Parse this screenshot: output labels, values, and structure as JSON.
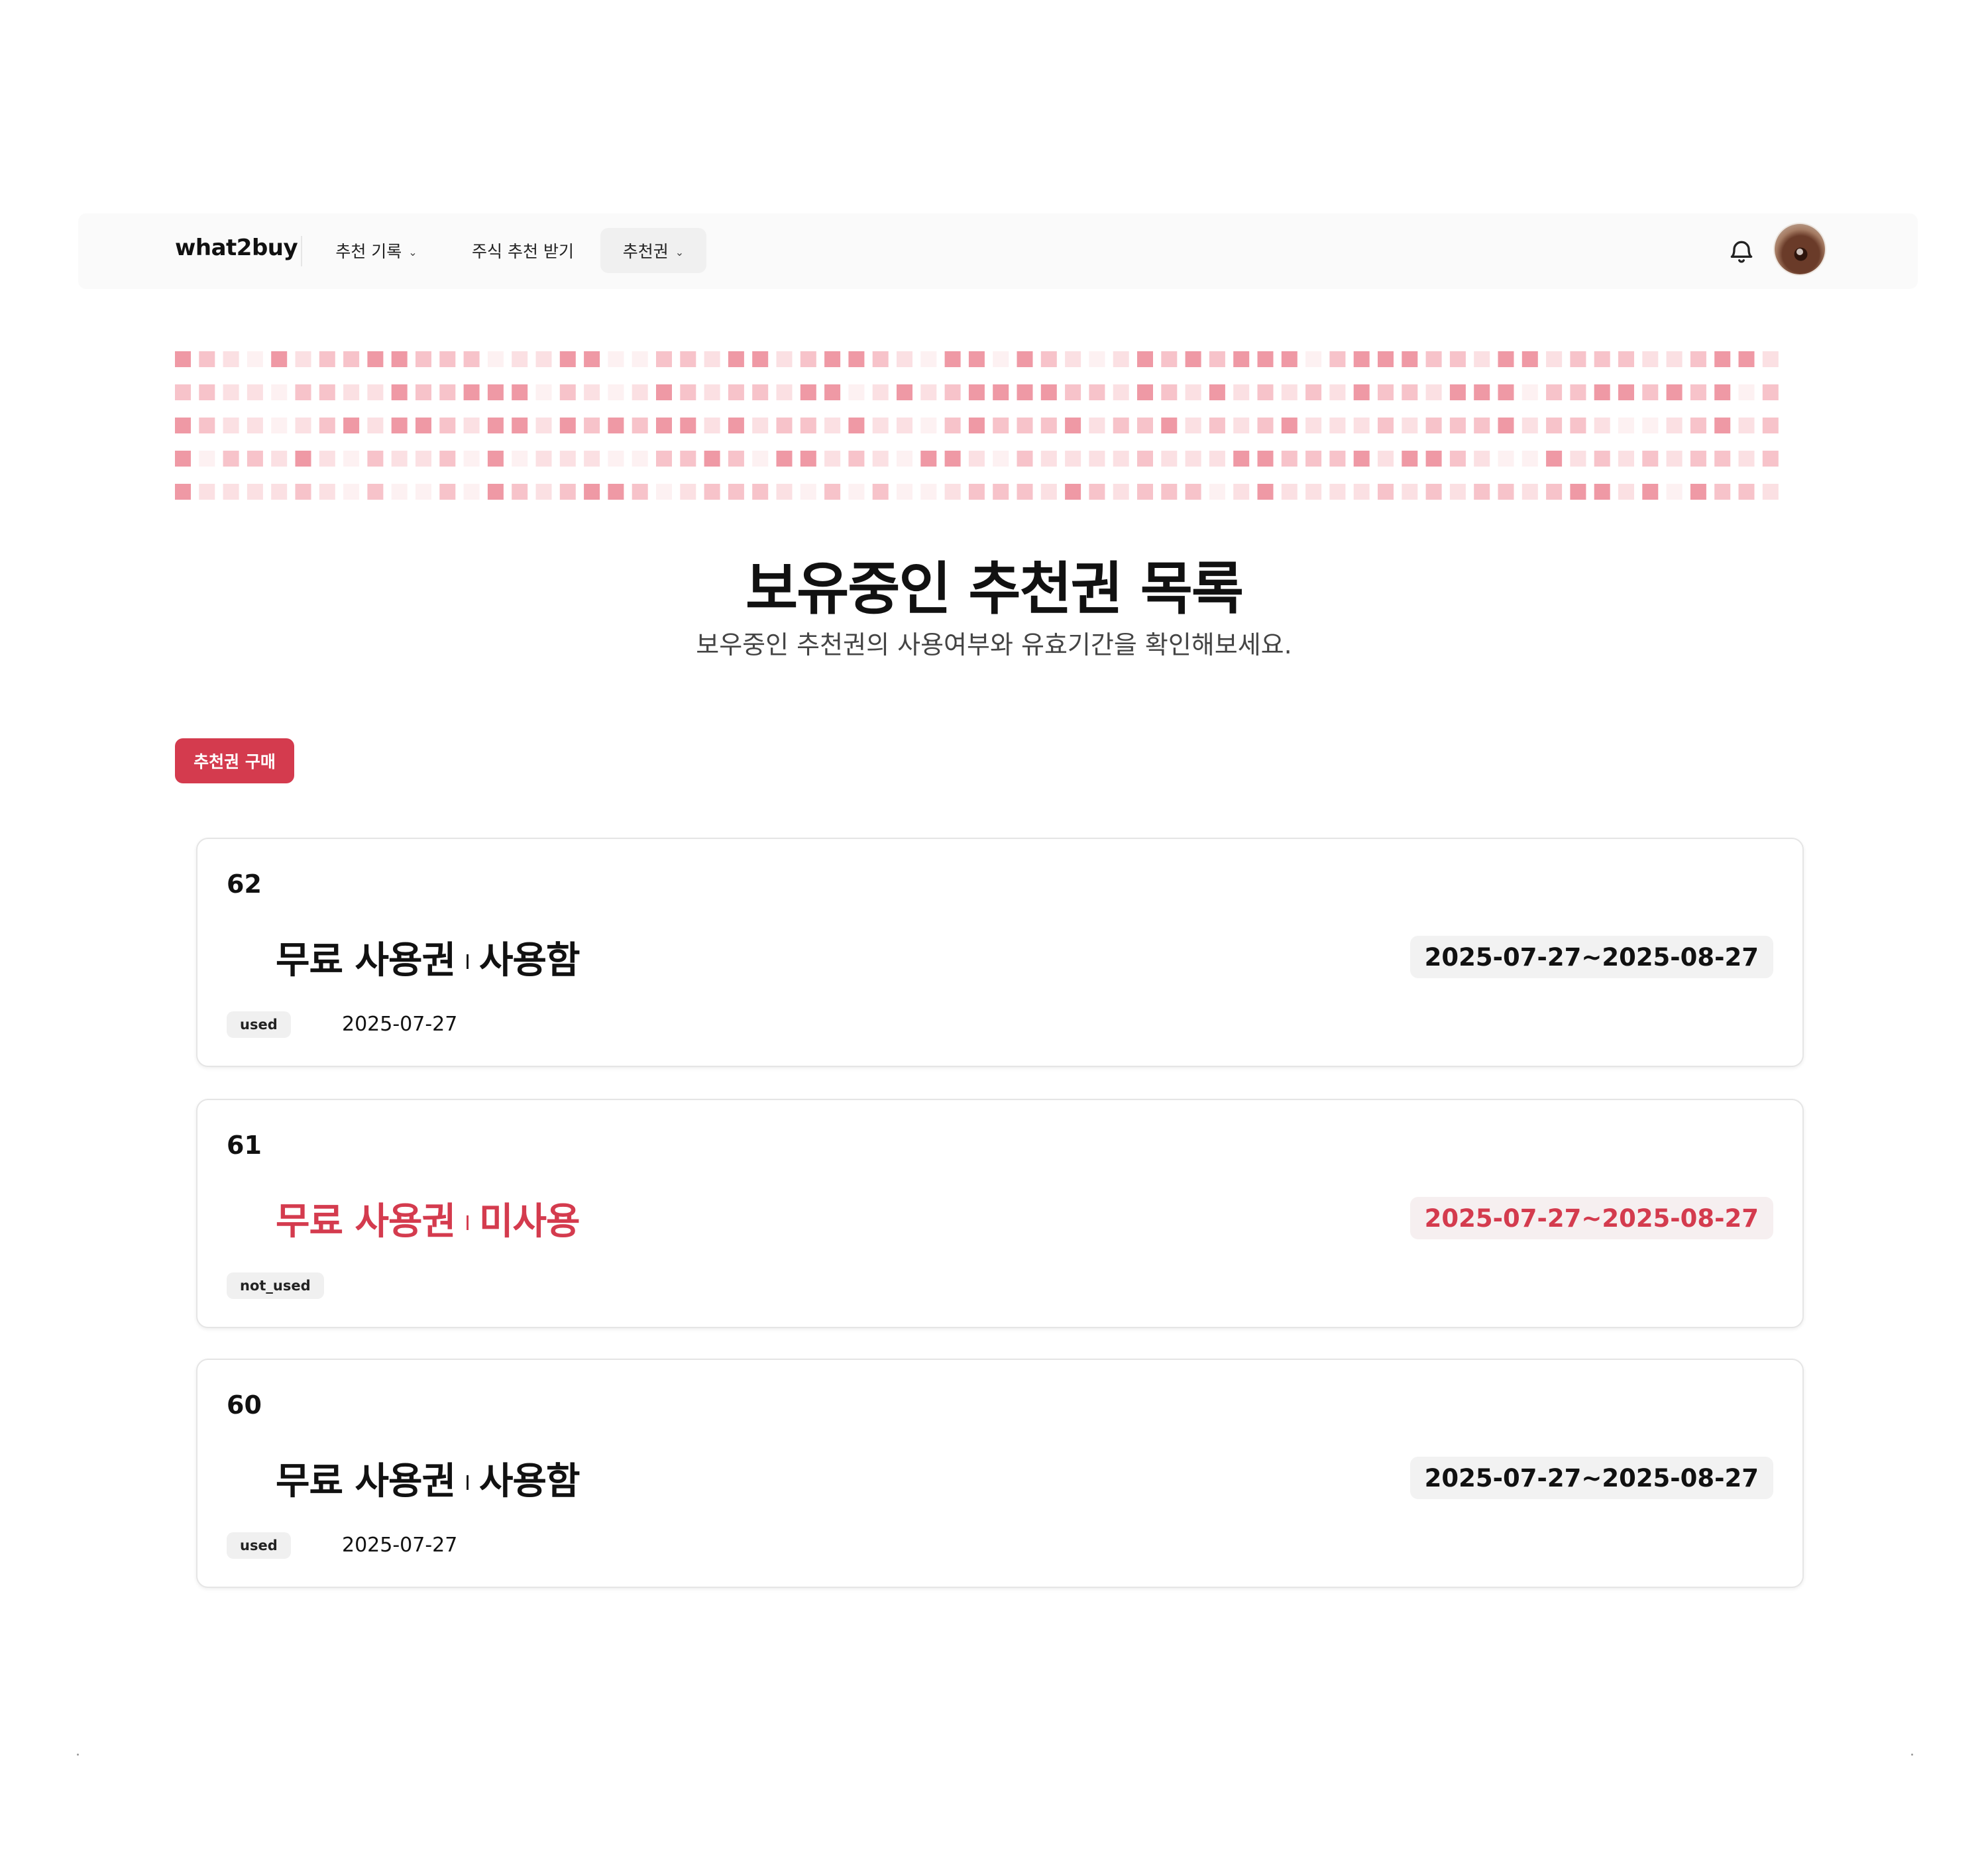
{
  "nav": {
    "brand": "what2buy",
    "items": [
      {
        "label": "추천 기록",
        "dropdown": true,
        "active": false
      },
      {
        "label": "주식 추천 받기",
        "dropdown": false,
        "active": false
      },
      {
        "label": "추천권",
        "dropdown": true,
        "active": true
      }
    ],
    "icons": [
      "bell-icon",
      "avatar"
    ]
  },
  "hero": {
    "title": "보유중인 추천권 목록",
    "subtitle": "보우중인 추천권의 사용여부와 유효기간을 확인해보세요."
  },
  "actions": {
    "buy_label": "추천권 구매"
  },
  "tickets": [
    {
      "id": "62",
      "name": "무료 사용권",
      "separator": "I",
      "status_text": "사용함",
      "period": "2025-07-27~2025-08-27",
      "status_code": "used",
      "used_date": "2025-07-27"
    },
    {
      "id": "61",
      "name": "무료 사용권",
      "separator": "I",
      "status_text": "미사용",
      "period": "2025-07-27~2025-08-27",
      "status_code": "not_used",
      "used_date": ""
    },
    {
      "id": "60",
      "name": "무료 사용권",
      "separator": "I",
      "status_text": "사용함",
      "period": "2025-07-27~2025-08-27",
      "status_code": "used",
      "used_date": "2025-07-27"
    }
  ],
  "colors": {
    "accent": "#d43b4e",
    "banner_tiles": [
      "#fdf1f2",
      "#fbe0e3",
      "#f7c3ca",
      "#ef99a5"
    ]
  },
  "banner_pattern": [
    "3210312233222011330022133123321033032101323233302333221331222112331",
    "2211022113223330210132122133013123333221321312121322133302233232302",
    "3211012313321331323233131221311023222312231212311121222312210012312",
    "3022131021120301110022320331210331021111211133222313321003121212212",
    "3111121020020321233201222102020012221321222013111121212212331303221"
  ]
}
